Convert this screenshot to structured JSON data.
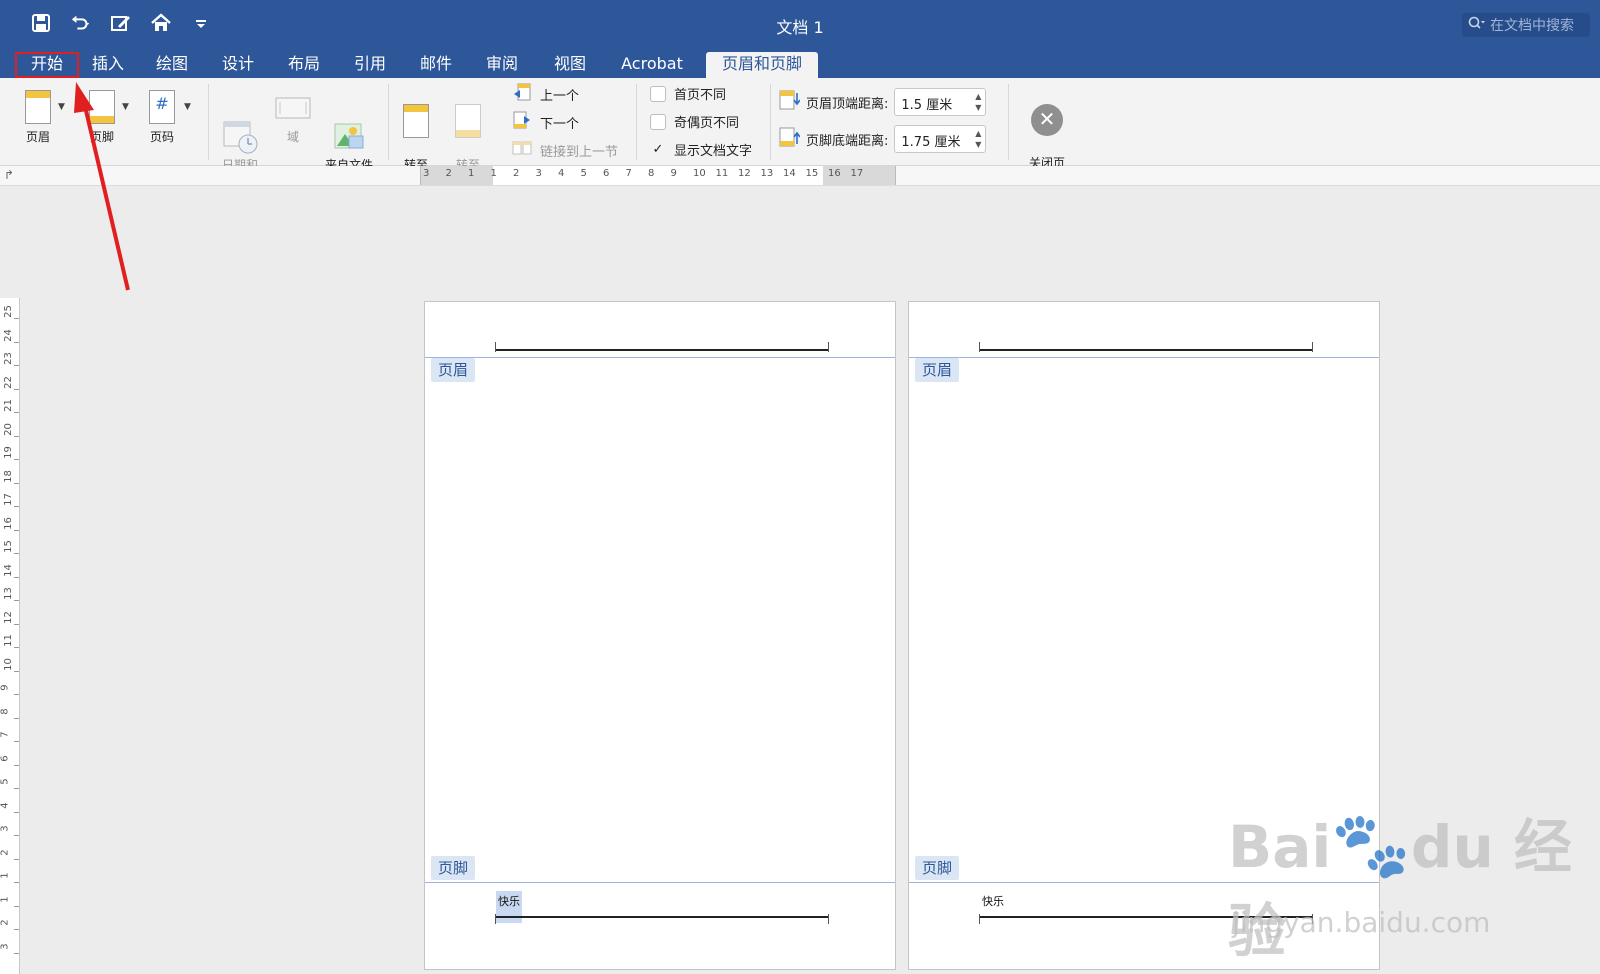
{
  "window": {
    "title": "文档 1",
    "search_placeholder": "在文档中搜索"
  },
  "quick_access": [
    {
      "name": "save-icon"
    },
    {
      "name": "undo-icon"
    },
    {
      "name": "edit-icon"
    },
    {
      "name": "home-icon"
    },
    {
      "name": "customize-icon"
    }
  ],
  "tabs": [
    {
      "label": "开始",
      "state": "annotated"
    },
    {
      "label": "插入"
    },
    {
      "label": "绘图"
    },
    {
      "label": "设计"
    },
    {
      "label": "布局"
    },
    {
      "label": "引用"
    },
    {
      "label": "邮件"
    },
    {
      "label": "审阅"
    },
    {
      "label": "视图"
    },
    {
      "label": "Acrobat"
    },
    {
      "label": "页眉和页脚",
      "state": "active"
    }
  ],
  "ribbon": {
    "header": "页眉",
    "footer": "页脚",
    "page_number": "页码",
    "date_time": "日期和\n时间",
    "field": "域",
    "picture_from_file": "来自文件\n的图片",
    "goto_header": "转至\n页眉",
    "goto_footer": "转至\n页脚",
    "previous": "上一个",
    "next": "下一个",
    "link_previous": "链接到上一节",
    "diff_first_page": "首页不同",
    "diff_odd_even": "奇偶页不同",
    "show_doc_text": "显示文档文字",
    "header_top_label": "页眉顶端距离:",
    "header_top_value": "1.5 厘米",
    "footer_bottom_label": "页脚底端距离:",
    "footer_bottom_value": "1.75 厘米",
    "close": "关闭页\n眉和页脚"
  },
  "ruler": {
    "h_numbers": [
      "3",
      "2",
      "1",
      "1",
      "2",
      "3",
      "4",
      "5",
      "6",
      "7",
      "8",
      "9",
      "10",
      "11",
      "12",
      "13",
      "14",
      "15",
      "16",
      "17"
    ],
    "v_numbers": [
      "25",
      "24",
      "23",
      "22",
      "21",
      "20",
      "19",
      "18",
      "17",
      "16",
      "15",
      "14",
      "13",
      "12",
      "11",
      "10",
      "9",
      "8",
      "7",
      "6",
      "5",
      "4",
      "3",
      "2",
      "1",
      "1",
      "2",
      "3"
    ]
  },
  "pages": [
    {
      "header_tag": "页眉",
      "footer_tag": "页脚",
      "footer_text": "快乐",
      "selected": true
    },
    {
      "header_tag": "页眉",
      "footer_tag": "页脚",
      "footer_text": "快乐",
      "selected": false
    }
  ],
  "colors": {
    "title_bar": "#2d5799",
    "annotation": "#e02020"
  }
}
